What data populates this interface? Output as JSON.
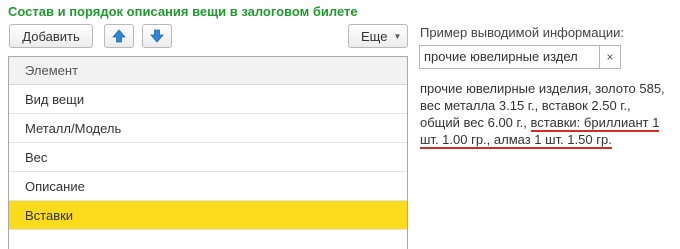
{
  "section_title": "Состав и порядок описания вещи в залоговом билете",
  "toolbar": {
    "add_label": "Добавить",
    "up_icon": "arrow-up-icon",
    "down_icon": "arrow-down-icon",
    "more_label": "Еще",
    "accent_color": "#2f86d6"
  },
  "table": {
    "header": "Элемент",
    "rows": [
      "Вид вещи",
      "Металл/Модель",
      "Вес",
      "Описание",
      "Вставки"
    ],
    "selected_index": 4,
    "selected_color": "#fbdc1d"
  },
  "preview": {
    "label": "Пример выводимой информации:",
    "combo_value": "прочие ювелирные издел",
    "text_plain": "прочие ювелирные изделия, золото 585, вес металла 3.15 г., вставок 2.50 г., общий вес 6.00 г., ",
    "text_underlined": "вставки: бриллиант 1 шт. 1.00 гр., алмаз 1 шт. 1.50 гр."
  }
}
